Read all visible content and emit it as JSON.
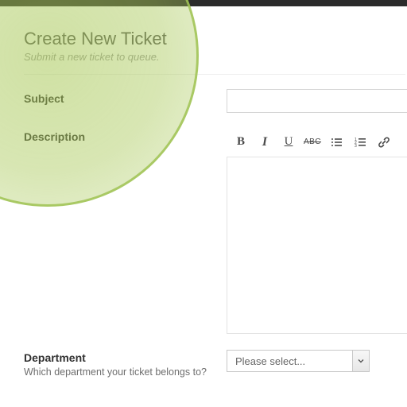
{
  "header": {
    "title": "Create New Ticket",
    "subtitle": "Submit a new ticket to queue."
  },
  "fields": {
    "subject": {
      "label": "Subject"
    },
    "description": {
      "label": "Description",
      "toolbar": {
        "bold": "B",
        "italic": "I",
        "underline": "U",
        "strike": "ABC"
      }
    },
    "department": {
      "label": "Department",
      "help": "Which department your ticket belongs to?",
      "placeholder": "Please select..."
    }
  }
}
